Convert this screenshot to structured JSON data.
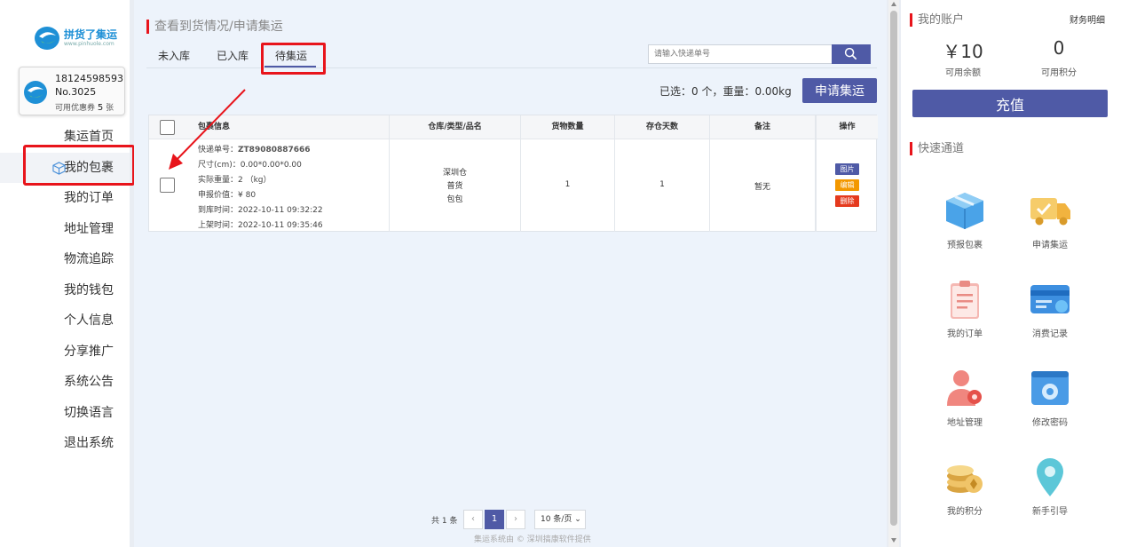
{
  "brand": {
    "name": "拼货了集运",
    "sub": "www.pinhuole.com"
  },
  "user": {
    "phone": "18124598593",
    "no": "No.3025",
    "coupon_prefix": "可用优惠券",
    "coupon_count": "5",
    "coupon_suffix": "张"
  },
  "nav": [
    "集运首页",
    "我的包裹",
    "我的订单",
    "地址管理",
    "物流追踪",
    "我的钱包",
    "个人信息",
    "分享推广",
    "系统公告",
    "切换语言",
    "退出系统"
  ],
  "page_title": "查看到货情况/申请集运",
  "tabs": [
    "未入库",
    "已入库",
    "待集运"
  ],
  "search": {
    "placeholder": "请输入快递单号"
  },
  "summary": "已选：0 个，重量：0.00kg",
  "apply_label": "申请集运",
  "table": {
    "headers": [
      "包裹信息",
      "仓库/类型/品名",
      "货物数量",
      "存仓天数",
      "备注",
      "操作"
    ],
    "row": {
      "tracking": "快递单号：",
      "tracking_no": "ZT89080887666",
      "size": "尺寸(cm)：0.00*0.00*0.00",
      "weight": "实际重量：2 （kg）",
      "declared": "申报价值：¥ 80",
      "arrive": "到库时间：2022-10-11 09:32:22",
      "shelf": "上架时间：2022-10-11 09:35:46",
      "warehouse": "深圳仓",
      "type": "普货",
      "name": "包包",
      "qty": "1",
      "days": "1",
      "note": "暂无",
      "ops": {
        "pic": "图片",
        "edit": "编辑",
        "del": "删除"
      }
    }
  },
  "pager": {
    "total": "共 1 条",
    "current": "1",
    "size": "10 条/页"
  },
  "footer": "集运系统由 © 深圳搞康软件提供",
  "account": {
    "title": "我的账户",
    "finance_link": "财务明细",
    "balance": "￥10",
    "balance_label": "可用余额",
    "points": "0",
    "points_label": "可用积分",
    "recharge": "充值"
  },
  "quick": {
    "title": "快速通道",
    "items": [
      "预报包裹",
      "申请集运",
      "我的订单",
      "消费记录",
      "地址管理",
      "修改密码",
      "我的积分",
      "新手引导"
    ]
  },
  "colors": {
    "primary": "#4f5aa6",
    "highlight": "#e8141b",
    "edit": "#f39800",
    "delete": "#e53a1e"
  }
}
